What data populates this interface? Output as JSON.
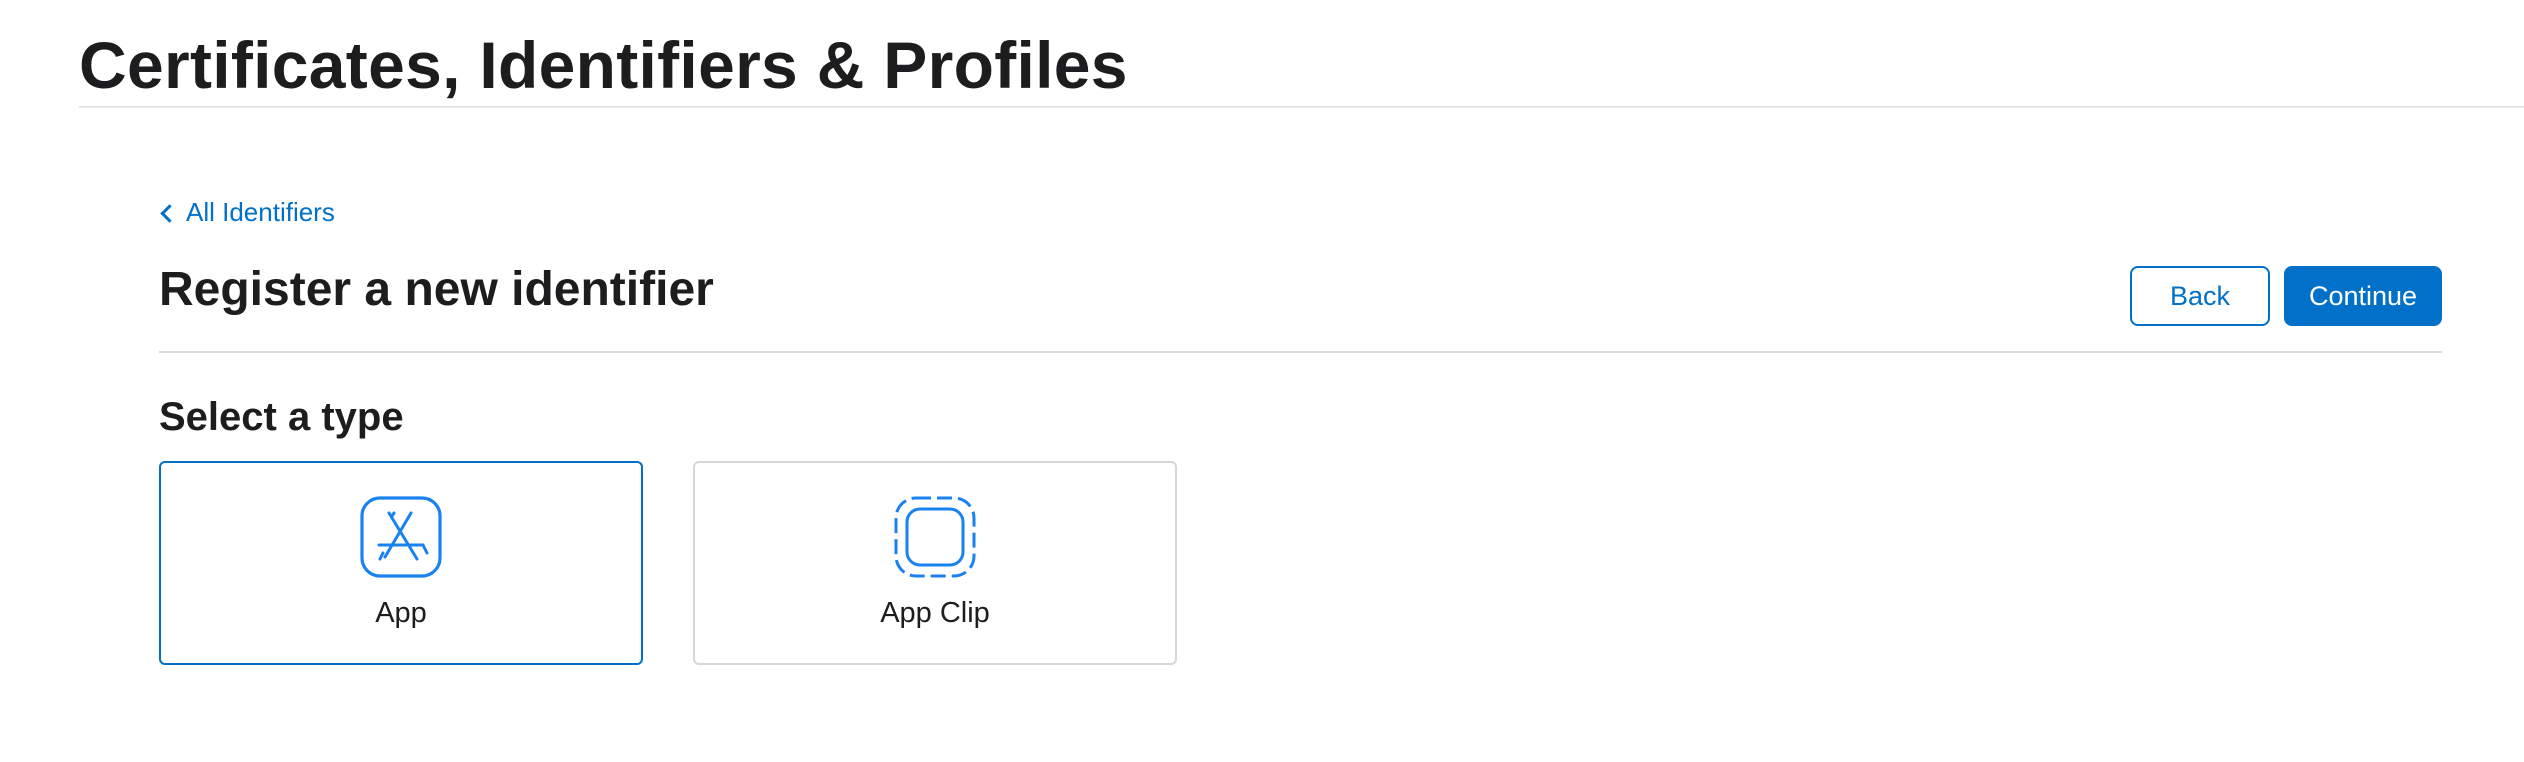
{
  "header": {
    "title": "Certificates, Identifiers & Profiles"
  },
  "navigation": {
    "back_link_label": "All Identifiers"
  },
  "main": {
    "title": "Register a new identifier",
    "buttons": {
      "back_label": "Back",
      "continue_label": "Continue"
    },
    "type_section": {
      "title": "Select a type",
      "selected": "App",
      "options": [
        {
          "label": "App",
          "icon": "app-store-icon"
        },
        {
          "label": "App Clip",
          "icon": "app-clip-icon"
        }
      ]
    }
  },
  "colors": {
    "accent": "#0070c9",
    "icon_blue": "#1a82f0",
    "title_text": "#1d1d1f",
    "card_border": "#d6d6d6",
    "divider": "#d9d9d9"
  }
}
